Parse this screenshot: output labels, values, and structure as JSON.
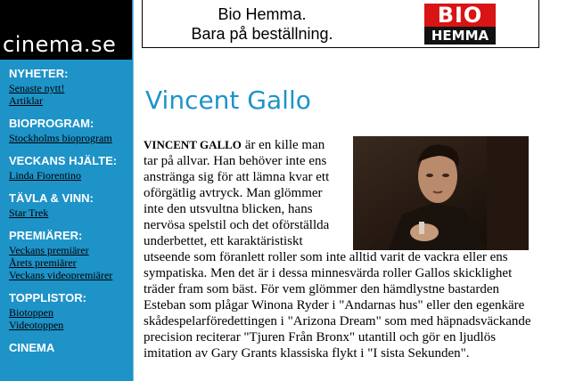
{
  "logo": {
    "text": "cinema.se"
  },
  "banner": {
    "line1": "Bio Hemma.",
    "line2": "Bara på beställning.",
    "logo_top": "BIO",
    "logo_bottom": "HEMMA"
  },
  "nav": {
    "sections": [
      {
        "heading": "NYHETER:",
        "links": [
          "Senaste nytt!",
          "Artiklar"
        ]
      },
      {
        "heading": "BIOPROGRAM:",
        "links": [
          "Stockholms bioprogram"
        ]
      },
      {
        "heading": "VECKANS HJÄLTE:",
        "links": [
          "Linda Fiorentino"
        ]
      },
      {
        "heading": "TÄVLA & VINN:",
        "links": [
          "Star Trek"
        ]
      },
      {
        "heading": "PREMIÄRER:",
        "links": [
          "Veckans premiärer",
          "Årets premiärer",
          "Veckans videopremiärer"
        ]
      },
      {
        "heading": "TOPPLISTOR:",
        "links": [
          "Biotoppen",
          "Videotoppen"
        ]
      },
      {
        "heading": "CINEMA",
        "links": []
      }
    ]
  },
  "article": {
    "title": "Vincent Gallo",
    "lead_name": "VINCENT GALLO",
    "body": " är en kille man tar på allvar. Han behöver inte ens anstränga sig för att lämna kvar ett oförgätlig avtryck. Man glömmer inte den utsvultna blicken, hans nervösa spelstil och det oförställda underbettet, ett karaktäristiskt utseende som föranlett roller som inte alltid varit de vackra eller ens sympatiska. Men det är i dessa minnesvärda roller Gallos skicklighet träder fram som bäst. För vem glömmer den hämdlystne bastarden Esteban som plågar Winona Ryder i \"Andarnas hus\" eller den egenkäre skådespelarföredettingen i \"Arizona Dream\" som med häpnadsväckande precision reciterar \"Tjuren Från Bronx\" utantill och gör en ljudlös imitation av Gary Grants klassiska flykt i \"I sista Sekunden\"."
  },
  "colors": {
    "sidebar": "#1e93c8",
    "title": "#1e93c8",
    "logo_bg": "#000000",
    "bio_red": "#d81414"
  }
}
